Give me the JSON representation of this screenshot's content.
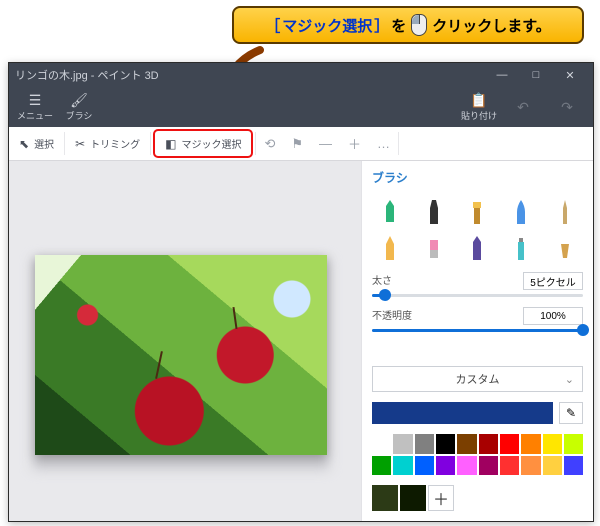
{
  "callout": {
    "open_bracket": "［",
    "magic_select": "マジック選択",
    "close_bracket": "］",
    "wo": "を",
    "click_text": "クリックします。"
  },
  "window": {
    "title": "リンゴの木.jpg - ペイント 3D",
    "win_buttons": {
      "min": "—",
      "max": "□",
      "close": "✕"
    }
  },
  "toolbar1": {
    "menu": "メニュー",
    "brush": "ブラシ",
    "paste": "貼り付け"
  },
  "toolbar2": {
    "select": "選択",
    "trimming": "トリミング",
    "magic_select": "マジック選択",
    "more": "…"
  },
  "side": {
    "panel_title": "ブラシ",
    "thickness_label": "太さ",
    "thickness_value": "5ピクセル",
    "thickness_percent": 6,
    "opacity_label": "不透明度",
    "opacity_value": "100%",
    "opacity_percent": 100,
    "custom_label": "カスタム",
    "current_color": "#153a8a",
    "palette": [
      "#ffffff",
      "#c0c0c0",
      "#808080",
      "#000000",
      "#7b3f00",
      "#a80000",
      "#ff0000",
      "#ff8000",
      "#ffe600",
      "#c8ff00",
      "#00a000",
      "#00d0d0",
      "#0060ff",
      "#8000e0",
      "#ff60ff",
      "#a00060",
      "#ff3030",
      "#ff9040",
      "#ffd040",
      "#4040ff"
    ],
    "extra_palette": [
      "#2c3a16",
      "#0d1a00"
    ],
    "add_swatch": "＋"
  }
}
